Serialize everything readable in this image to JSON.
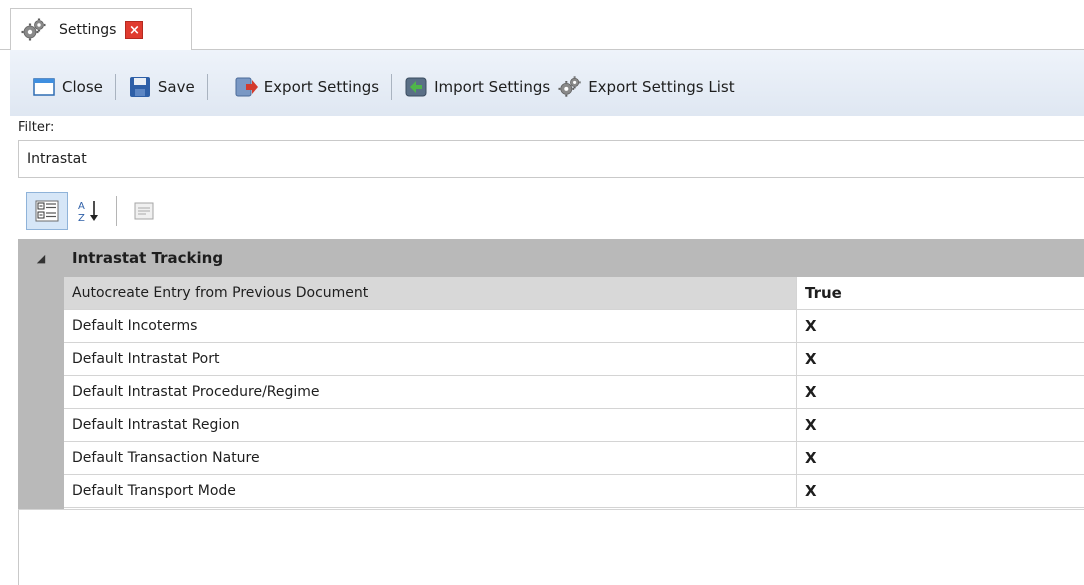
{
  "tab": {
    "label": "Settings",
    "close_glyph": "×",
    "icon": "gears-icon",
    "close_color": "#e03b2f"
  },
  "toolbar": {
    "close_label": "Close",
    "save_label": "Save",
    "export_label": "Export Settings",
    "import_label": "Import Settings",
    "export_list_label": "Export Settings List"
  },
  "filter": {
    "label": "Filter:",
    "value": "Intrastat"
  },
  "grid": {
    "category": {
      "title": "Intrastat Tracking",
      "toggle_glyph": "◢"
    },
    "properties": [
      {
        "name": "Autocreate Entry from Previous Document",
        "value": "True"
      },
      {
        "name": "Default Incoterms",
        "value": "X"
      },
      {
        "name": "Default Intrastat Port",
        "value": "X"
      },
      {
        "name": "Default Intrastat Procedure/Regime",
        "value": "X"
      },
      {
        "name": "Default Intrastat Region",
        "value": "X"
      },
      {
        "name": "Default Transaction Nature",
        "value": "X"
      },
      {
        "name": "Default Transport Mode",
        "value": "X"
      }
    ]
  },
  "colors": {
    "toolbar_bg": "#dfe7f2",
    "gutter": "#b9b9b9",
    "selected_row": "#d8d8d8"
  }
}
